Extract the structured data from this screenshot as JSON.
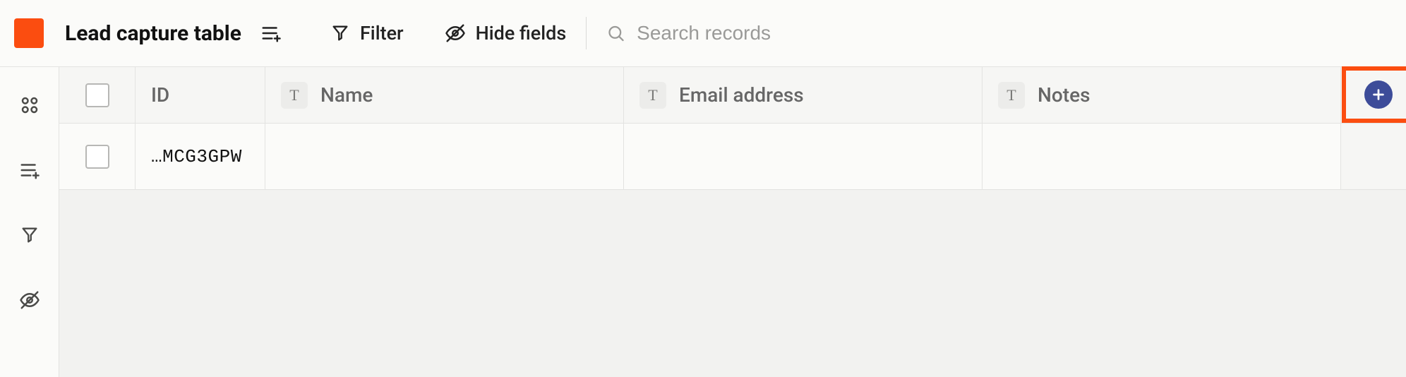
{
  "toolbar": {
    "title": "Lead capture table",
    "filter_label": "Filter",
    "hide_fields_label": "Hide fields",
    "search_placeholder": "Search records"
  },
  "columns": {
    "id_label": "ID",
    "name_label": "Name",
    "email_label": "Email address",
    "notes_label": "Notes",
    "type_glyph": "T"
  },
  "rows": [
    {
      "id": "…MCG3GPW",
      "name": "",
      "email": "",
      "notes": ""
    }
  ],
  "colors": {
    "brand": "#fb4d10",
    "add_btn": "#3d4c99"
  }
}
